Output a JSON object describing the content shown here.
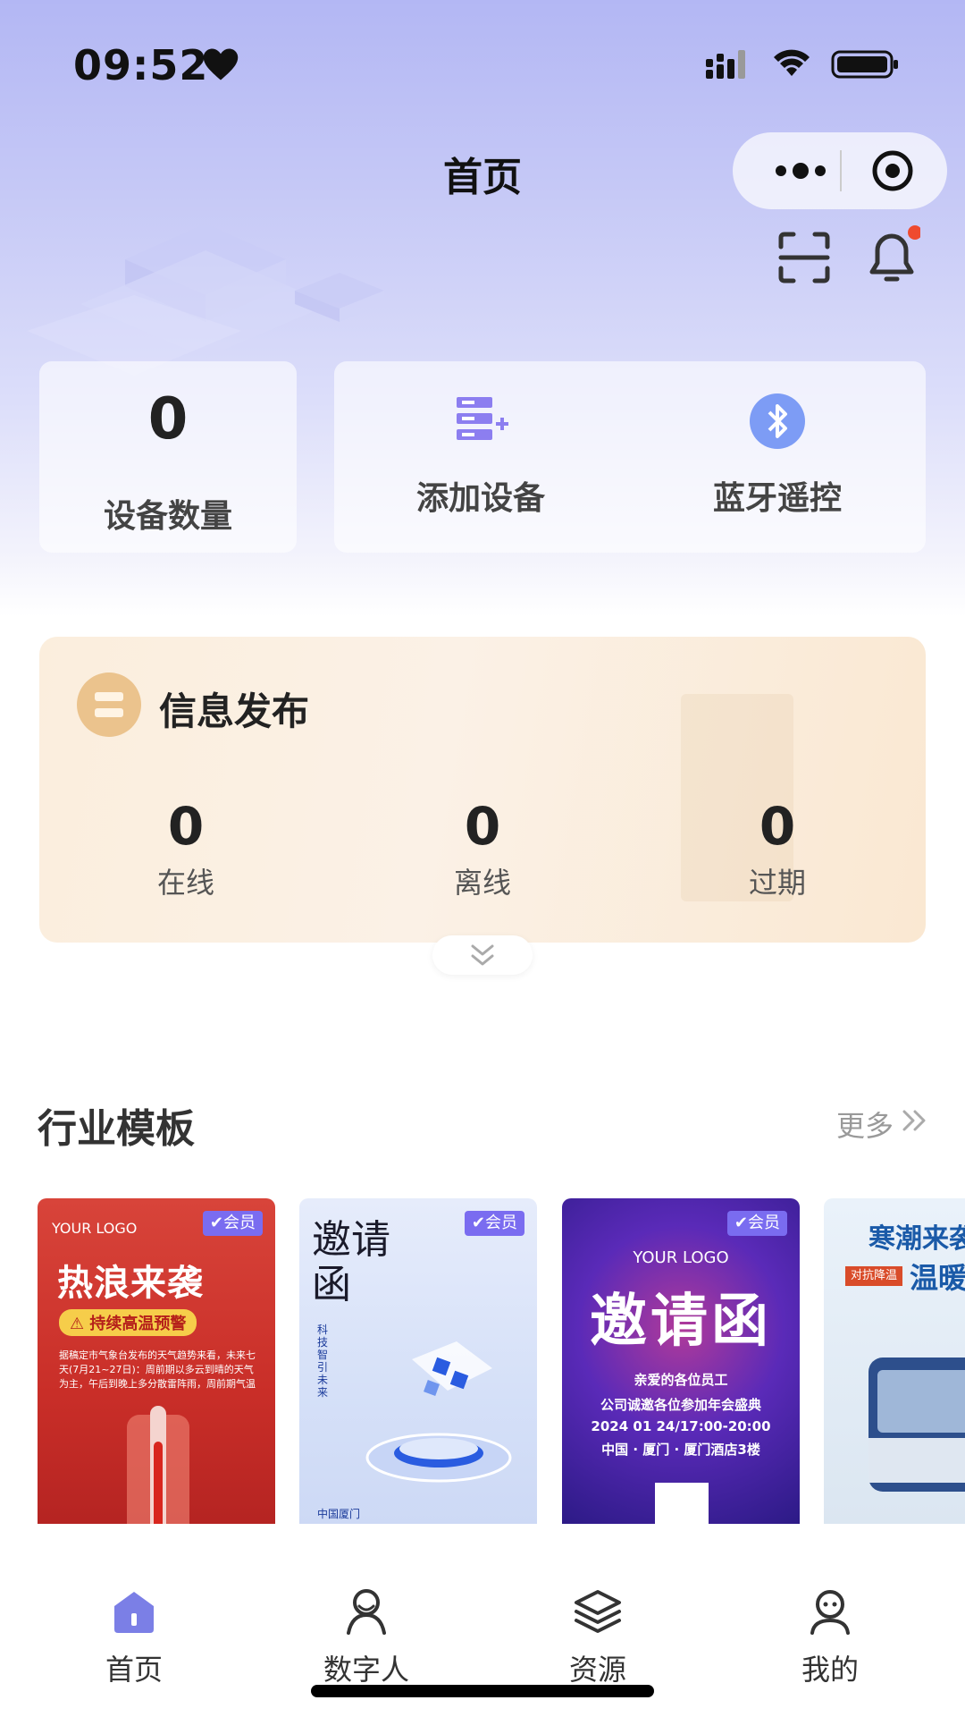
{
  "status_bar": {
    "time": "09:52",
    "icons": [
      "heart-icon",
      "signal-icon",
      "wifi-icon",
      "battery-icon"
    ]
  },
  "nav": {
    "title": "首页",
    "icons": [
      "more-dots-icon",
      "target-icon",
      "scan-icon",
      "bell-icon"
    ],
    "bell_has_dot": true
  },
  "summary": {
    "device_count": "0",
    "device_count_label": "设备数量",
    "add_device_label": "添加设备",
    "bluetooth_label": "蓝牙遥控"
  },
  "info": {
    "title": "信息发布",
    "stats": [
      {
        "value": "0",
        "label": "在线"
      },
      {
        "value": "0",
        "label": "离线"
      },
      {
        "value": "0",
        "label": "过期"
      }
    ]
  },
  "templates": {
    "title": "行业模板",
    "more_label": "更多",
    "member_badge": "✔会员",
    "items": [
      {
        "logo": "YOUR LOGO",
        "title": "热浪来袭",
        "pill": "⚠ 持续高温预警",
        "body": "据稿定市气象台发布的天气趋势来看，未来七天(7月21~27日)：周前期以多云到晴的天气为主，午后到晚上多分散雷阵雨，周前期气温"
      },
      {
        "title": "邀请函",
        "sub": "科技智引未来",
        "foot": "中国厦门"
      },
      {
        "logo": "YOUR LOGO",
        "title": "邀请函",
        "lines": [
          "亲爱的各位员工",
          "公司诚邀各位参加年会盛典",
          "2024 01 24/17:00-20:00",
          "中国 · 厦门 · 厦门酒店3楼"
        ]
      },
      {
        "title1": "寒潮来袭",
        "tag": "对抗降温",
        "title2": "温暖"
      }
    ]
  },
  "tabbar": {
    "items": [
      {
        "label": "首页",
        "icon": "home-icon",
        "active": true
      },
      {
        "label": "数字人",
        "icon": "digital-human-icon",
        "active": false
      },
      {
        "label": "资源",
        "icon": "layers-icon",
        "active": false
      },
      {
        "label": "我的",
        "icon": "profile-icon",
        "active": false
      }
    ]
  },
  "colors": {
    "accent": "#7b7fe6",
    "hero_top": "#b3b7f4",
    "info_card": "#fbeedd",
    "info_icon": "#ebc38d",
    "notification_dot": "#ef4a2f",
    "member_badge": "#7a6cf0"
  }
}
